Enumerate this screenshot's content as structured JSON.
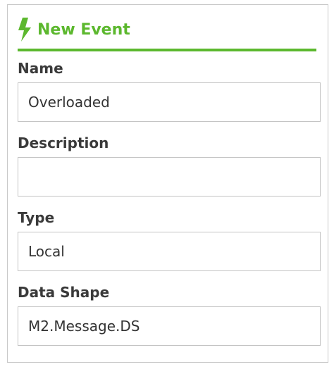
{
  "header": {
    "icon": "lightning-bolt-icon",
    "title": "New Event",
    "accent_color": "#5cb82e"
  },
  "fields": {
    "name": {
      "label": "Name",
      "value": "Overloaded"
    },
    "description": {
      "label": "Description",
      "value": ""
    },
    "type": {
      "label": "Type",
      "value": "Local"
    },
    "data_shape": {
      "label": "Data Shape",
      "value": "M2.Message.DS"
    }
  }
}
